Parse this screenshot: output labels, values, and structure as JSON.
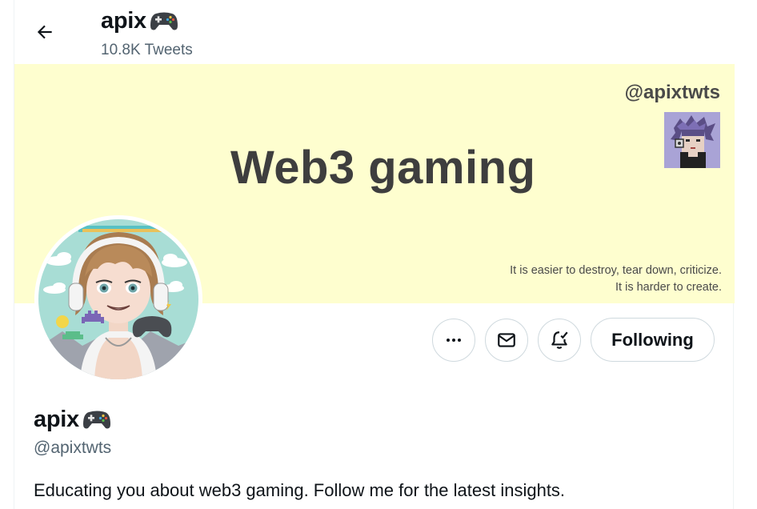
{
  "header": {
    "name": "apix",
    "name_icon": "video-game-controller-icon",
    "tweet_count": "10.8K Tweets",
    "back_icon": "arrow-left-icon"
  },
  "banner": {
    "handle": "@apixtwts",
    "title": "Web3 gaming",
    "quote_line1": "It is easier to destroy, tear down, criticize.",
    "quote_line2": "It is harder to create.",
    "background_color": "#fefecf"
  },
  "actions": {
    "more_icon": "more-horizontal-icon",
    "message_icon": "envelope-icon",
    "notify_icon": "bell-check-icon",
    "follow_label": "Following"
  },
  "profile": {
    "name": "apix",
    "handle": "@apixtwts",
    "bio": "Educating you about web3 gaming. Follow me for the latest insights."
  }
}
